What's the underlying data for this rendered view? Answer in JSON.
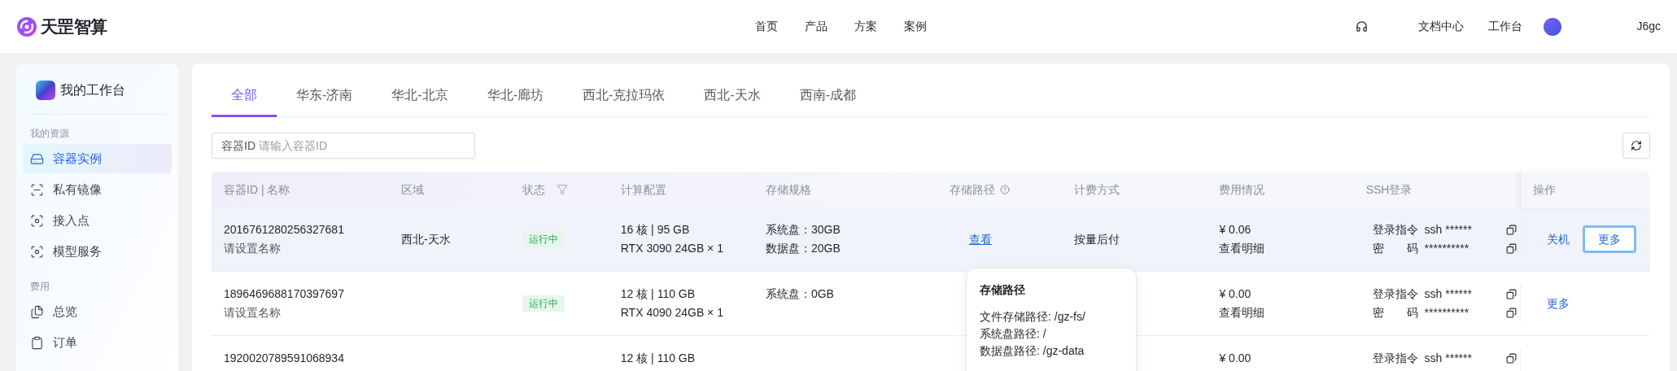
{
  "header": {
    "logo_text": "天罡智算",
    "nav": [
      {
        "label": "首页",
        "selected": false
      },
      {
        "label": "产品",
        "selected": false
      },
      {
        "label": "方案",
        "selected": false
      },
      {
        "label": "案例",
        "selected": false
      }
    ],
    "links": [
      "文档中心",
      "工作台"
    ],
    "user": "J6gc"
  },
  "sidebar": {
    "title": "我的工作台",
    "sections": [
      {
        "heading": "我的资源",
        "items": [
          {
            "label": "容器实例",
            "selected": true
          },
          {
            "label": "私有镜像",
            "selected": false
          },
          {
            "label": "接入点",
            "selected": false
          },
          {
            "label": "模型服务",
            "selected": false
          }
        ]
      },
      {
        "heading": "费用",
        "items": [
          {
            "label": "总览",
            "selected": false
          },
          {
            "label": "订单",
            "selected": false
          }
        ]
      }
    ]
  },
  "tabs": [
    {
      "label": "全部",
      "selected": true
    },
    {
      "label": "华东-济南",
      "selected": false
    },
    {
      "label": "华北-北京",
      "selected": false
    },
    {
      "label": "华北-廊坊",
      "selected": false
    },
    {
      "label": "西北-克拉玛依",
      "selected": false
    },
    {
      "label": "西北-天水",
      "selected": false
    },
    {
      "label": "西南-成都",
      "selected": false
    }
  ],
  "search": {
    "label": "容器ID",
    "placeholder": "请输入容器ID"
  },
  "table": {
    "columns": [
      "容器ID | 名称",
      "区域",
      "状态",
      "计算配置",
      "存储规格",
      "存储路径",
      "计费方式",
      "费用情况",
      "SSH登录",
      "操作"
    ],
    "rows": [
      {
        "highlighted": true,
        "id": "2016761280256327681",
        "name": "请设置名称",
        "region": "西北-天水",
        "status": "运行中",
        "compute": [
          "16 核 | 95 GB",
          "RTX 3090 24GB × 1"
        ],
        "storage": [
          "系统盘：30GB",
          "数据盘：20GB"
        ],
        "path": "查看",
        "billing": "按量后付",
        "cost": [
          "¥ 0.06",
          "查看明细"
        ],
        "ssh": [
          {
            "label": "登录指令",
            "value": "ssh ******"
          },
          {
            "label": "密码",
            "value": "**********"
          }
        ],
        "actions": [
          {
            "label": "关机",
            "focused": false
          },
          {
            "label": "更多",
            "focused": true
          }
        ]
      },
      {
        "highlighted": false,
        "id": "1896469688170397697",
        "name": "请设置名称",
        "status": "运行中",
        "compute": [
          "12 核 | 110 GB",
          "RTX 4090 24GB × 1"
        ],
        "storage": [
          "系统盘：0GB"
        ],
        "cost": [
          "¥ 0.00",
          "查看明细"
        ],
        "ssh": [
          {
            "label": "登录指令",
            "value": "ssh ******"
          },
          {
            "label": "密码",
            "value": "**********"
          }
        ],
        "actions": [
          {
            "label": "更多",
            "focused": false
          }
        ]
      },
      {
        "highlighted": false,
        "id": "1920020789591068934",
        "compute": [
          "12 核 | 110 GB"
        ],
        "cost": [
          "¥ 0.00"
        ],
        "ssh": [
          {
            "label": "登录指令",
            "value": "ssh ******"
          }
        ]
      }
    ]
  },
  "popover": {
    "title": "存储路径",
    "lines": [
      "文件存储路径: /gz-fs/",
      "系统盘路径: /",
      "数据盘路径: /gz-data"
    ]
  }
}
